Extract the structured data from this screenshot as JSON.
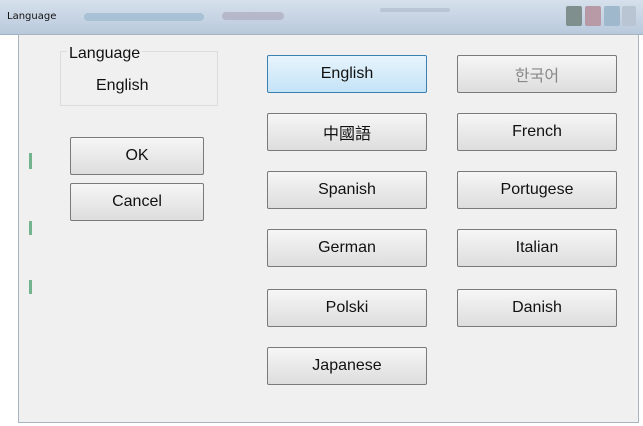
{
  "window": {
    "title": "Language"
  },
  "language_group": {
    "caption": "Language",
    "current_value": "English"
  },
  "actions": {
    "ok_label": "OK",
    "cancel_label": "Cancel"
  },
  "languages": [
    {
      "label": "English",
      "selected": true
    },
    {
      "label": "한국어",
      "disabled": true
    },
    {
      "label": "中國語"
    },
    {
      "label": "French"
    },
    {
      "label": "Spanish"
    },
    {
      "label": "Portugese"
    },
    {
      "label": "German"
    },
    {
      "label": "Italian"
    },
    {
      "label": "Polski"
    },
    {
      "label": "Danish"
    },
    {
      "label": "Japanese"
    }
  ],
  "colors": {
    "selected_border": "#3c7fb1",
    "selected_fill": "#c4e3f7",
    "window_bg": "#f0f0f0"
  }
}
